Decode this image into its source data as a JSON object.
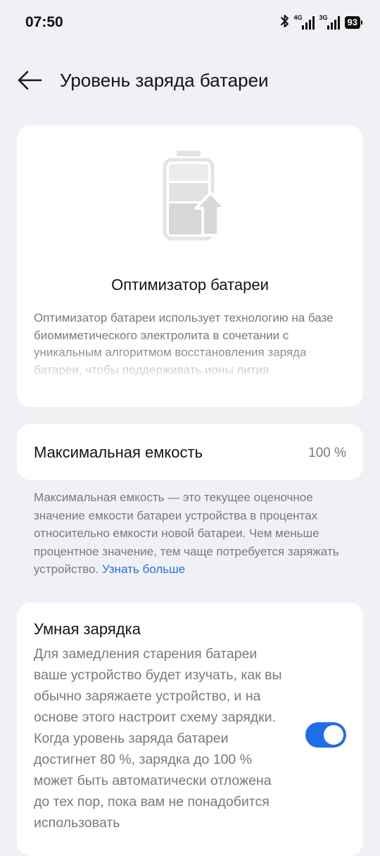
{
  "status_bar": {
    "time": "07:50",
    "network_1": "4G",
    "network_2": "3G",
    "battery_level": "93"
  },
  "header": {
    "title": "Уровень заряда батареи"
  },
  "optimizer": {
    "title": "Оптимизатор батареи",
    "description": "Оптимизатор батареи использует технологию на базе биомиметического электролита в сочетании с уникальным алгоритмом восстановления заряда батареи, чтобы поддерживать ионы лития"
  },
  "capacity": {
    "label": "Максимальная емкость",
    "value": "100 %",
    "note": "Максимальная емкость — это текущее оценочное значение емкости батареи устройства в процентах относительно емкости новой батареи. Чем меньше процентное значение, тем чаще потребуется заряжать устройство.",
    "learn_more": "Узнать больше"
  },
  "smart_charging": {
    "title": "Умная зарядка",
    "description": "Для замедления старения батареи ваше устройство будет изучать, как вы обычно заряжаете устройство, и на основе этого настроит схему зарядки. Когда уровень заряда батареи достигнет 80 %, зарядка до 100 % может быть автоматически отложена до тех пор, пока вам не понадобится использовать",
    "enabled": true
  },
  "colors": {
    "accent": "#1f6ee6",
    "link": "#2a6fdb",
    "background": "#f0f1f5",
    "card": "#ffffff"
  },
  "icons": {
    "back": "arrow-left-icon",
    "bluetooth": "bluetooth-icon",
    "signal": "signal-bars-icon",
    "battery": "battery-icon",
    "illustration": "battery-upgrade-icon"
  }
}
